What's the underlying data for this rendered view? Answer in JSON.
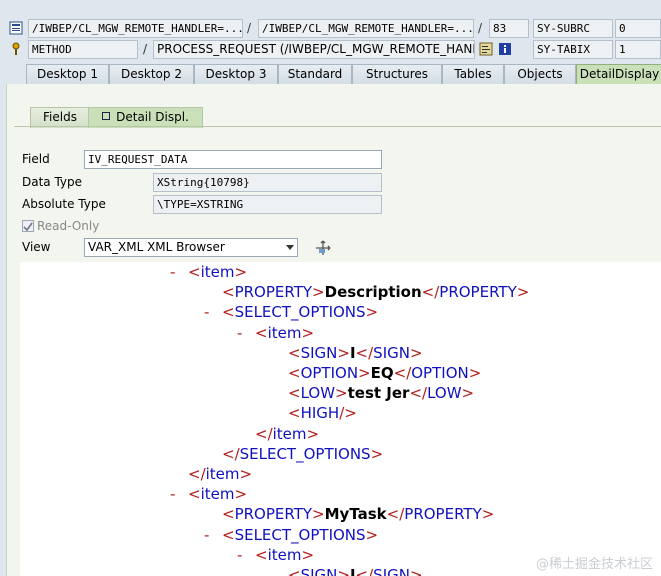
{
  "header": {
    "row1": {
      "program": "/IWBEP/CL_MGW_REMOTE_HANDLER=...",
      "include": "/IWBEP/CL_MGW_REMOTE_HANDLER=...",
      "line": "83",
      "sysvar": "SY-SUBRC",
      "sysvar_value": "0"
    },
    "row2": {
      "type": "METHOD",
      "event": "PROCESS_REQUEST (/IWBEP/CL_MGW_REMOTE_HAND...",
      "sysvar": "SY-TABIX",
      "sysvar_value": "1"
    },
    "icons": [
      "source-icon",
      "method-icon",
      "display-source-icon",
      "info-icon"
    ]
  },
  "tabs": [
    "Desktop 1",
    "Desktop 2",
    "Desktop 3",
    "Standard",
    "Structures",
    "Tables",
    "Objects",
    "DetailDisplay"
  ],
  "active_tab": "DetailDisplay",
  "subtabs": [
    "Fields",
    "Detail Displ."
  ],
  "active_subtab": "Detail Displ.",
  "detail": {
    "field_label": "Field",
    "field_value": "IV_REQUEST_DATA",
    "datatype_label": "Data Type",
    "datatype_value": "XString{10798}",
    "abstype_label": "Absolute Type",
    "abstype_value": "\\TYPE=XSTRING",
    "readonly_label": "Read-Only",
    "readonly_checked": true,
    "view_label": "View",
    "view_value": "VAR_XML XML Browser"
  },
  "xml_tree": [
    {
      "marker": "-",
      "open": "<",
      "tag": "item",
      "close": ">",
      "text": "",
      "end": ""
    },
    {
      "marker": "",
      "open": "<",
      "tag": "PROPERTY",
      "close": ">",
      "text": "Description",
      "end": "</PROPERTY>"
    },
    {
      "marker": "-",
      "open": "<",
      "tag": "SELECT_OPTIONS",
      "close": ">",
      "text": "",
      "end": ""
    },
    {
      "marker": "-",
      "open": "<",
      "tag": "item",
      "close": ">",
      "text": "",
      "end": ""
    },
    {
      "marker": "",
      "open": "<",
      "tag": "SIGN",
      "close": ">",
      "text": "I",
      "end": "</SIGN>"
    },
    {
      "marker": "",
      "open": "<",
      "tag": "OPTION",
      "close": ">",
      "text": "EQ",
      "end": "</OPTION>"
    },
    {
      "marker": "",
      "open": "<",
      "tag": "LOW",
      "close": ">",
      "text": "test Jer",
      "end": "</LOW>"
    },
    {
      "marker": "",
      "open": "<",
      "tag": "HIGH",
      "close": "/>",
      "text": "",
      "end": ""
    },
    {
      "marker": "",
      "open": "</",
      "tag": "item",
      "close": ">",
      "text": "",
      "end": ""
    },
    {
      "marker": "",
      "open": "</",
      "tag": "SELECT_OPTIONS",
      "close": ">",
      "text": "",
      "end": ""
    },
    {
      "marker": "",
      "open": "</",
      "tag": "item",
      "close": ">",
      "text": "",
      "end": ""
    },
    {
      "marker": "-",
      "open": "<",
      "tag": "item",
      "close": ">",
      "text": "",
      "end": ""
    },
    {
      "marker": "",
      "open": "<",
      "tag": "PROPERTY",
      "close": ">",
      "text": "MyTask",
      "end": "</PROPERTY>"
    },
    {
      "marker": "-",
      "open": "<",
      "tag": "SELECT_OPTIONS",
      "close": ">",
      "text": "",
      "end": ""
    },
    {
      "marker": "-",
      "open": "<",
      "tag": "item",
      "close": ">",
      "text": "",
      "end": ""
    },
    {
      "marker": "",
      "open": "<",
      "tag": "SIGN",
      "close": ">",
      "text": "I",
      "end": "</SIGN>"
    }
  ],
  "watermark": "@稀土掘金技术社区",
  "colors": {
    "tag": "#1010c0",
    "bracket": "#b31b1b",
    "active_tab": "#c9e0b9"
  }
}
